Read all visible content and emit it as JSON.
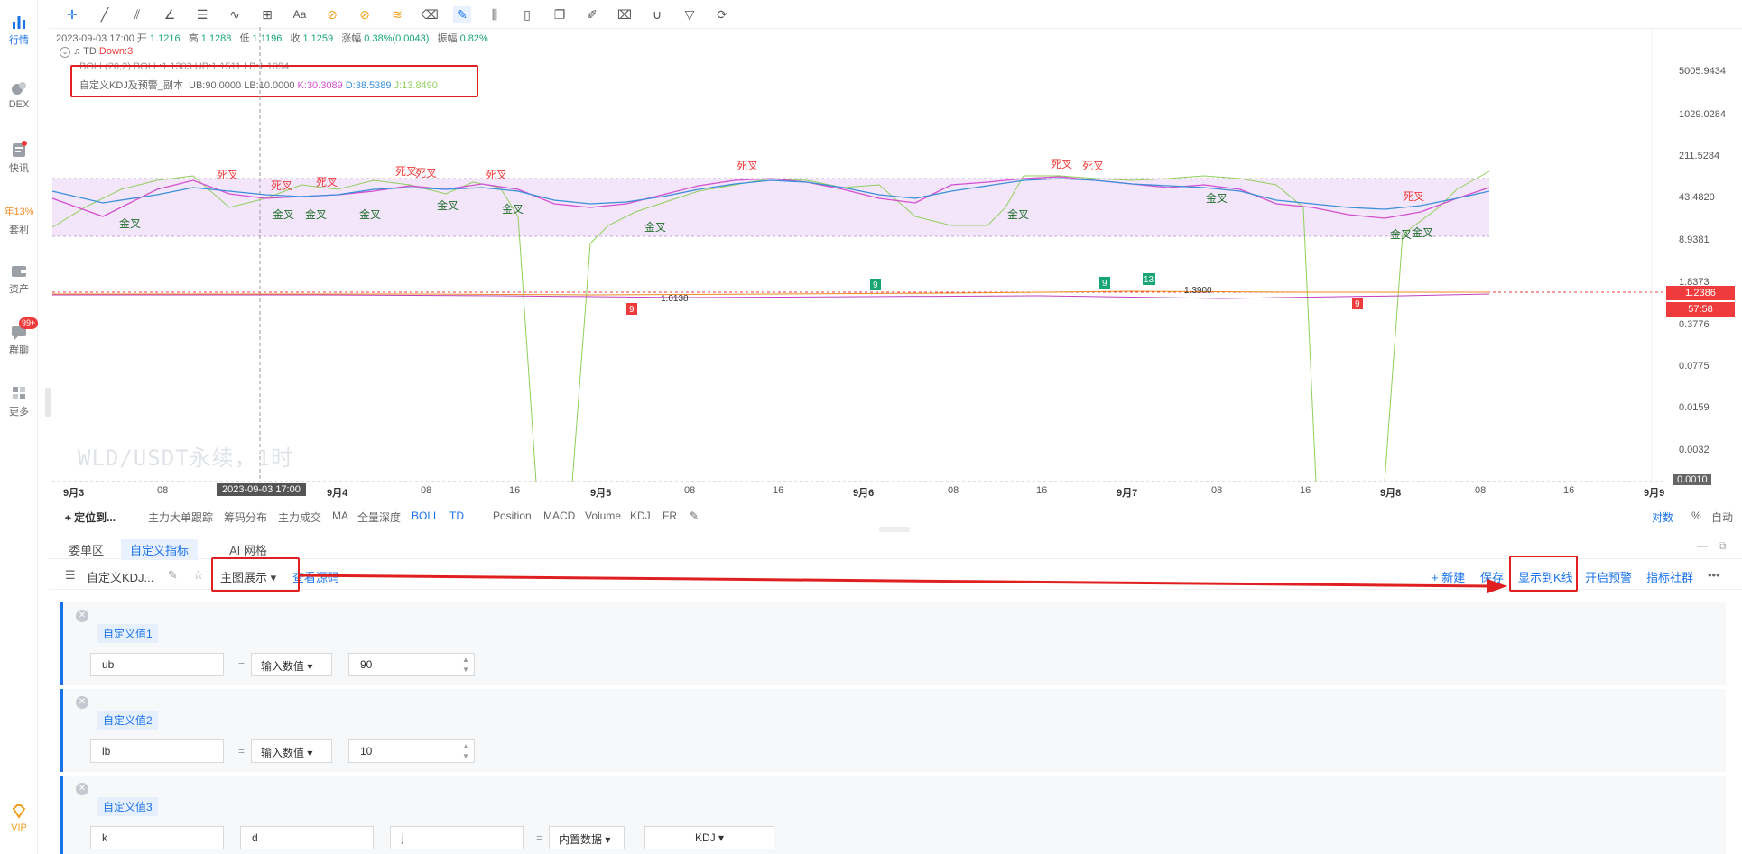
{
  "sidebar": {
    "items": [
      {
        "label": "行情",
        "icon": "bar-chart-icon"
      },
      {
        "label": "DEX",
        "icon": "dex-icon"
      },
      {
        "label": "快讯",
        "icon": "news-icon"
      },
      {
        "label": "套利",
        "badge_text": "年13%",
        "icon": "arbitrage-icon"
      },
      {
        "label": "资产",
        "icon": "wallet-icon"
      },
      {
        "label": "群聊",
        "badge": "99+",
        "icon": "chat-icon"
      },
      {
        "label": "更多",
        "icon": "grid-icon"
      },
      {
        "label": "VIP",
        "icon": "diamond-icon"
      }
    ]
  },
  "ohlc": {
    "datetime": "2023-09-03 17:00",
    "open_label": "开",
    "open": "1.1216",
    "high_label": "高",
    "high": "1.1288",
    "low_label": "低",
    "low": "1.1196",
    "close_label": "收",
    "close": "1.1259",
    "change_label": "涨幅",
    "change": "0.38%(0.0043)",
    "amp_label": "振幅",
    "amp": "0.82%"
  },
  "legend": {
    "td_name": "TD",
    "td_value": "Down:3",
    "boll_text": "BOLL(20,2)  BOLL:1.1303  UB:1.1511  LB:1.1094",
    "kdj_name": "自定义KDJ及预警_副本",
    "kdj_ub": "UB:90.0000",
    "kdj_lb": "LB:10.0000",
    "kdj_k": "K:30.3089",
    "kdj_d": "D:38.5389",
    "kdj_j": "J:13.8490"
  },
  "yaxis": [
    "5005.9434",
    "1029.0284",
    "211.5284",
    "43.4820",
    "8.9381",
    "1.8373",
    "0.3776",
    "0.0775",
    "0.0159",
    "0.0032",
    "0.0010"
  ],
  "price_tags": {
    "price": "1.2386",
    "countdown": "57:58"
  },
  "chart_labels": {
    "death_cross": "死叉",
    "golden_cross": "金叉",
    "price_1": "1.0138",
    "price_2": "1.3900",
    "td_9": "9",
    "td_13": "13"
  },
  "watermark": "WLD/USDT永续，1时",
  "xaxis": [
    "9月3",
    "08",
    "9月4",
    "08",
    "16",
    "9月5",
    "08",
    "16",
    "9月6",
    "08",
    "16",
    "9月7",
    "08",
    "16",
    "9月8",
    "08",
    "16",
    "9月9"
  ],
  "crosshair_date": "2023-09-03 17:00",
  "indicator_bar": {
    "locate": "定位到...",
    "items": [
      "主力大单跟踪",
      "筹码分布",
      "主力成交",
      "MA",
      "全量深度",
      "BOLL",
      "TD",
      "Position",
      "MACD",
      "Volume",
      "KDJ",
      "FR"
    ],
    "active": [
      "BOLL",
      "TD"
    ],
    "right": [
      "对数",
      "%",
      "自动"
    ]
  },
  "panel_tabs": [
    "委单区",
    "自定义指标",
    "AI 网格"
  ],
  "panel_toolbar": {
    "indicator_name": "自定义KDJ...",
    "display_mode": "主图展示",
    "view_source": "查看源码",
    "new": "+ 新建",
    "save": "保存",
    "show_kline": "显示到K线",
    "enable_alert": "开启预警",
    "community": "指标社群",
    "more": "•••"
  },
  "cards": [
    {
      "title": "自定义值1",
      "name": "ub",
      "op": "=",
      "type": "输入数值",
      "value": "90"
    },
    {
      "title": "自定义值2",
      "name": "lb",
      "op": "=",
      "type": "输入数值",
      "value": "10"
    },
    {
      "title": "自定义值3",
      "names": [
        "k",
        "d",
        "j"
      ],
      "op": "=",
      "type": "内置数据",
      "value": "KDJ"
    }
  ],
  "colors": {
    "accent": "#1a73e8",
    "red": "#ef3b3b",
    "green": "#17a673",
    "boll_fill": "#f3e6fb"
  }
}
